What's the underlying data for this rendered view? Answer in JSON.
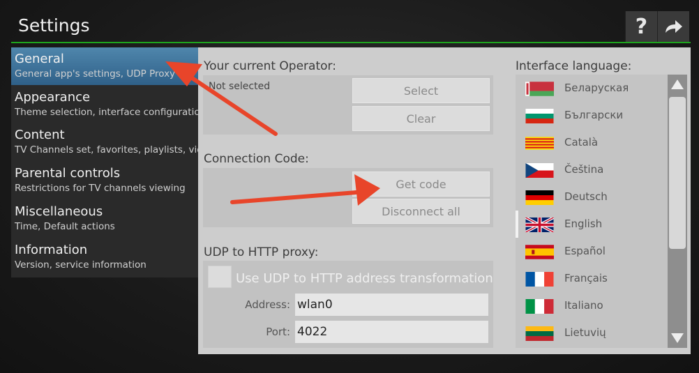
{
  "header": {
    "title": "Settings",
    "help_glyph": "?",
    "forward_glyph": "➜"
  },
  "colors": {
    "accent_green": "#1ea51e",
    "active_item": "#3f76a0",
    "arrow_red": "#e8452a"
  },
  "sidebar": {
    "items": [
      {
        "title": "General",
        "subtitle": "General app's settings, UDP Proxy",
        "active": true
      },
      {
        "title": "Appearance",
        "subtitle": "Theme selection, interface configuration"
      },
      {
        "title": "Content",
        "subtitle": "TV Channels set, favorites, playlists, video"
      },
      {
        "title": "Parental controls",
        "subtitle": "Restrictions for TV channels viewing"
      },
      {
        "title": "Miscellaneous",
        "subtitle": "Time, Default actions"
      },
      {
        "title": "Information",
        "subtitle": "Version, service information"
      }
    ]
  },
  "operator": {
    "label": "Your current Operator:",
    "value": "Not selected",
    "select_label": "Select",
    "clear_label": "Clear"
  },
  "connection": {
    "label": "Connection Code:",
    "get_code_label": "Get code",
    "disconnect_label": "Disconnect all"
  },
  "udp": {
    "label": "UDP to HTTP proxy:",
    "checkbox_label": "Use UDP to HTTP address transformation",
    "checked": false,
    "address_label": "Address:",
    "address_value": "wlan0",
    "port_label": "Port:",
    "port_value": "4022"
  },
  "language": {
    "label": "Interface language:",
    "items": [
      {
        "name": "Беларуская",
        "flag": "belarus-flag"
      },
      {
        "name": "Български",
        "flag": "bulgaria-flag"
      },
      {
        "name": "Català",
        "flag": "catalonia-flag"
      },
      {
        "name": "Čeština",
        "flag": "czech-flag"
      },
      {
        "name": "Deutsch",
        "flag": "germany-flag"
      },
      {
        "name": "English",
        "flag": "uk-flag",
        "selected": true
      },
      {
        "name": "Español",
        "flag": "spain-flag"
      },
      {
        "name": "Français",
        "flag": "france-flag"
      },
      {
        "name": "Italiano",
        "flag": "italy-flag"
      },
      {
        "name": "Lietuvių",
        "flag": "lithuania-flag"
      }
    ]
  }
}
